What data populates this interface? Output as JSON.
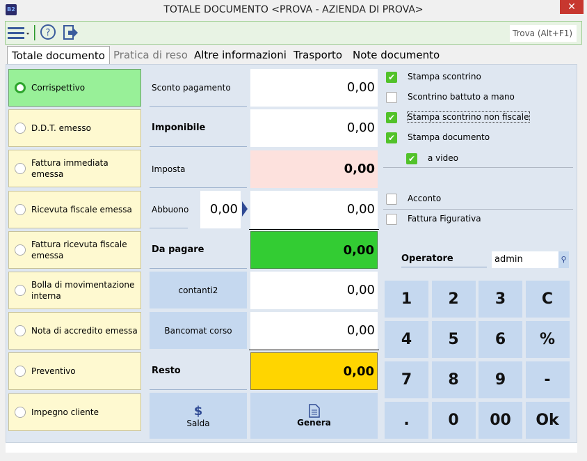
{
  "window": {
    "title": "TOTALE DOCUMENTO <PROVA - AZIENDA DI PROVA>",
    "app_icon": "B2",
    "close": "✕"
  },
  "toolbar": {
    "find": "Trova (Alt+F1)"
  },
  "tabs": [
    "Totale documento",
    "Pratica di reso",
    "Altre informazioni",
    "Trasporto",
    "Note documento"
  ],
  "doc_types": [
    "Corrispettivo",
    "D.D.T. emesso",
    "Fattura immediata emessa",
    "Ricevuta fiscale emessa",
    "Fattura ricevuta fiscale emessa",
    "Bolla di movimentazione interna",
    "Nota di accredito emessa",
    "Preventivo",
    "Impegno cliente"
  ],
  "selected_doc_type": "Corrispettivo",
  "totals": {
    "sconto_label": "Sconto pagamento",
    "sconto": "0,00",
    "imponibile_label": "Imponibile",
    "imponibile": "0,00",
    "imposta_label": "Imposta",
    "imposta": "0,00",
    "abbuono_label": "Abbuono",
    "abbuono_input": "0,00",
    "abbuono": "0,00",
    "da_pagare_label": "Da pagare",
    "da_pagare": "0,00",
    "contanti_label": "contanti2",
    "contanti": "0,00",
    "bancomat_label": "Bancomat corso",
    "bancomat": "0,00",
    "resto_label": "Resto",
    "resto": "0,00"
  },
  "actions": {
    "salda": "Salda",
    "genera": "Genera"
  },
  "options": [
    {
      "label": "Stampa scontrino",
      "checked": true
    },
    {
      "label": "Scontrino battuto a mano",
      "checked": false
    },
    {
      "label": "Stampa scontrino non fiscale",
      "checked": true
    },
    {
      "label": "Stampa documento",
      "checked": true
    },
    {
      "label": "a video",
      "checked": true
    },
    {
      "label": "Acconto",
      "checked": false
    },
    {
      "label": "Fattura Figurativa",
      "checked": false
    }
  ],
  "operator": {
    "label": "Operatore",
    "value": "admin"
  },
  "keypad": [
    "1",
    "2",
    "3",
    "C",
    "4",
    "5",
    "6",
    "%",
    "7",
    "8",
    "9",
    "-",
    ".",
    "0",
    "00",
    "Ok"
  ],
  "colors": {
    "selected": "#98f098",
    "doc": "#fef9d0",
    "imposta": "#fde1dd",
    "da_pagare": "#33cc33",
    "resto": "#ffd500",
    "check": "#52c22a"
  }
}
